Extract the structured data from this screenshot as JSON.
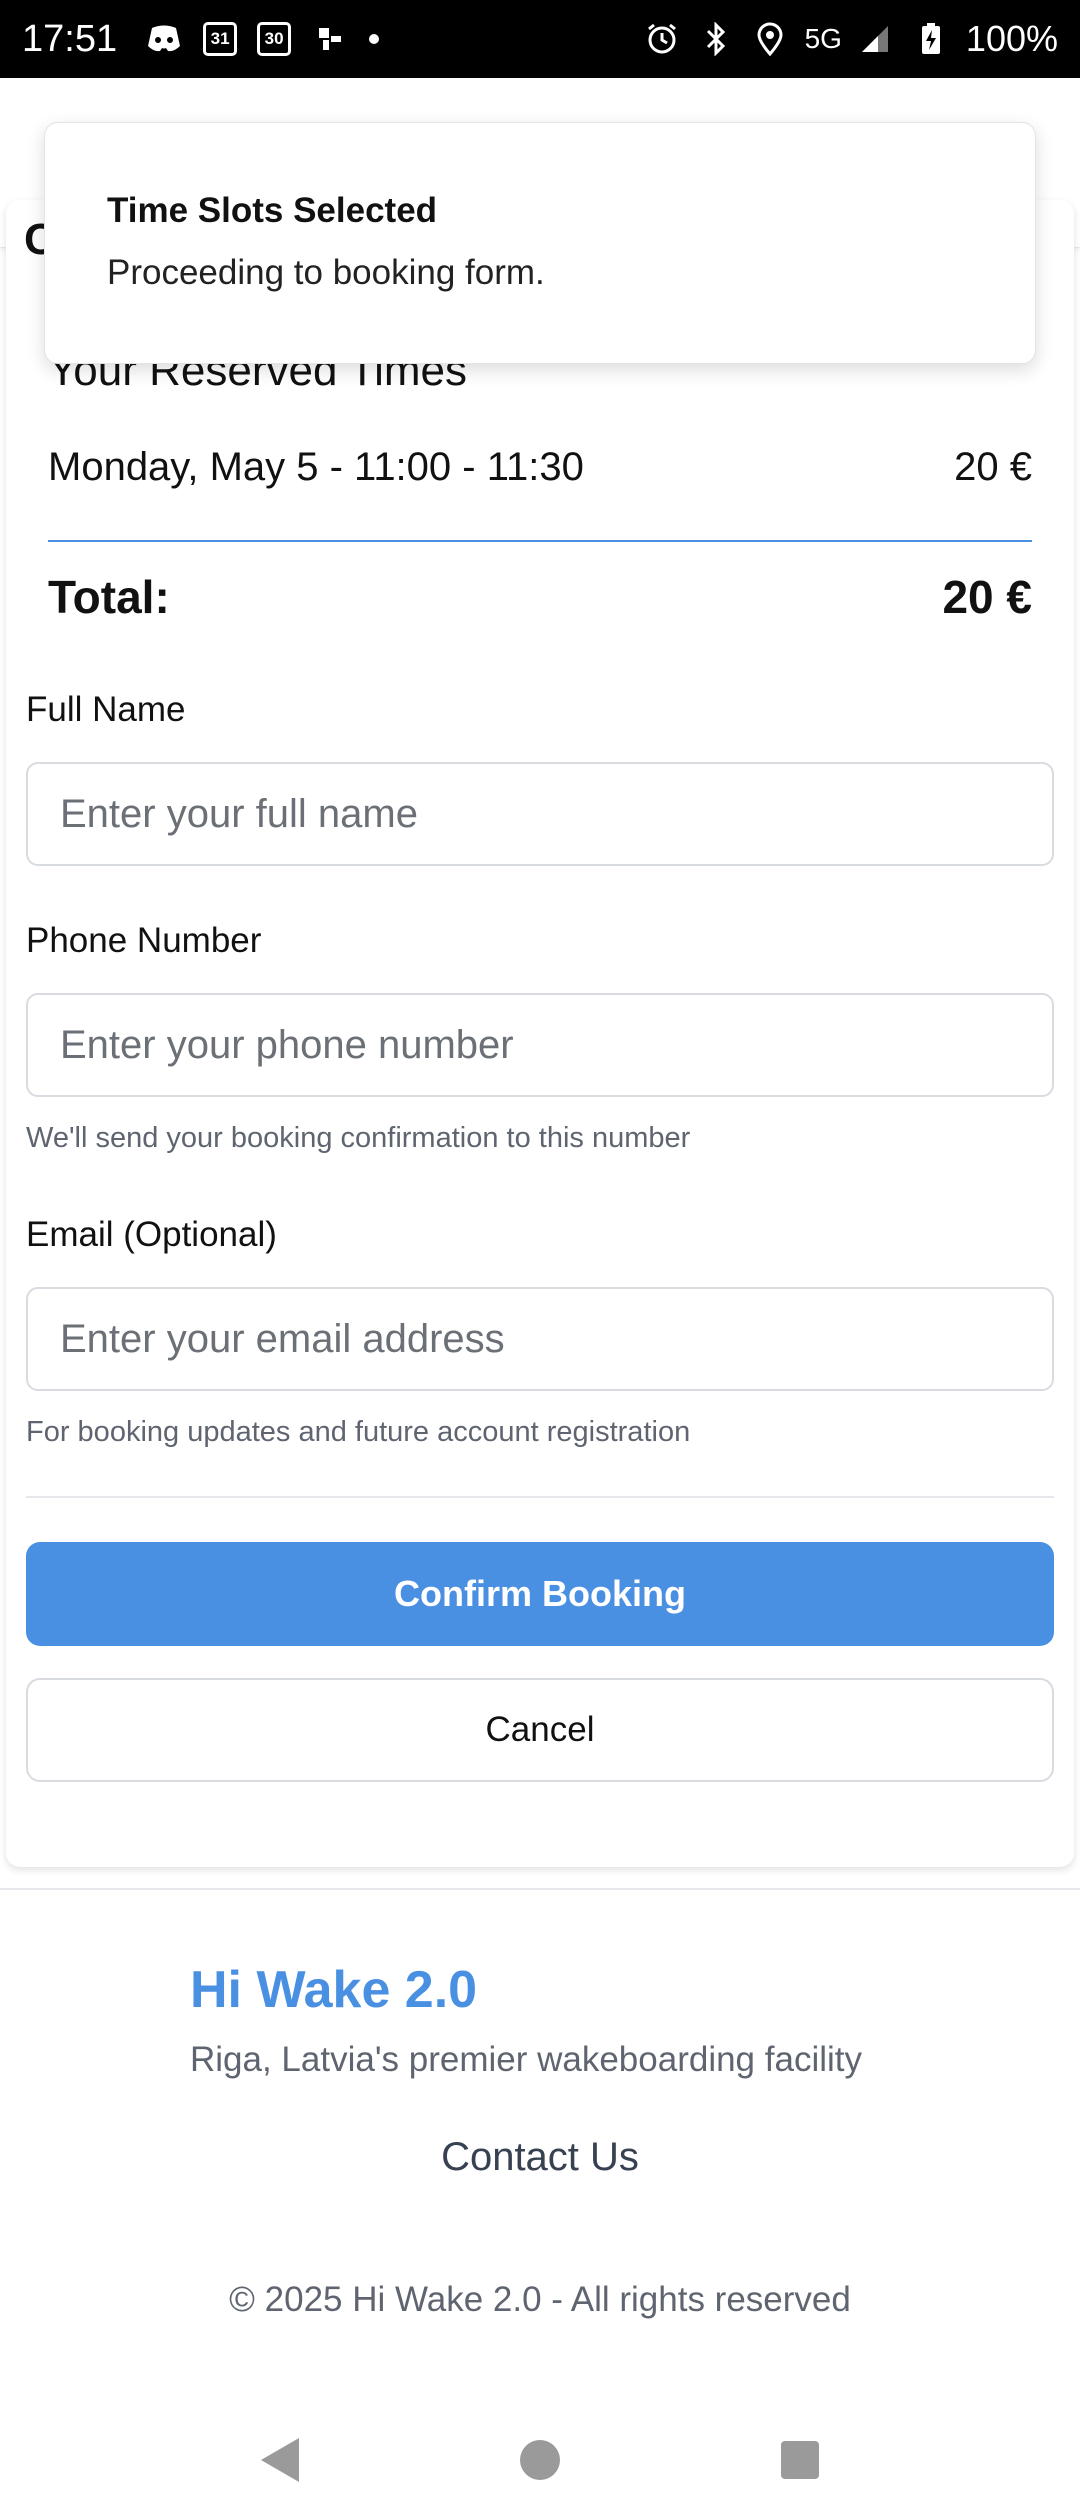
{
  "status_bar": {
    "time": "17:51",
    "calendar_day_1": "31",
    "calendar_day_2": "30",
    "network": "5G",
    "battery": "100%"
  },
  "booking": {
    "heading_partial": "C",
    "reserved_title": "Your Reserved Times",
    "slots": [
      {
        "label": "Monday, May 5 - 11:00 - 11:30",
        "price": "20 €"
      }
    ],
    "total_label": "Total:",
    "total_value": "20 €"
  },
  "form": {
    "full_name": {
      "label": "Full Name",
      "placeholder": "Enter your full name",
      "value": ""
    },
    "phone": {
      "label": "Phone Number",
      "placeholder": "Enter your phone number",
      "value": "",
      "hint": "We'll send your booking confirmation to this number"
    },
    "email": {
      "label": "Email (Optional)",
      "placeholder": "Enter your email address",
      "value": "",
      "hint": "For booking updates and future account registration"
    },
    "confirm_label": "Confirm Booking",
    "cancel_label": "Cancel"
  },
  "footer": {
    "brand": "Hi Wake 2.0",
    "tagline": "Riga, Latvia's premier wakeboarding facility",
    "contact": "Contact Us",
    "copyright": "© 2025 Hi Wake 2.0 - All rights reserved"
  },
  "toast": {
    "title": "Time Slots Selected",
    "message": "Proceeding to booking form."
  },
  "colors": {
    "accent": "#4a90e2",
    "status_bar_bg": "#000000",
    "muted_text": "#5f6570"
  }
}
